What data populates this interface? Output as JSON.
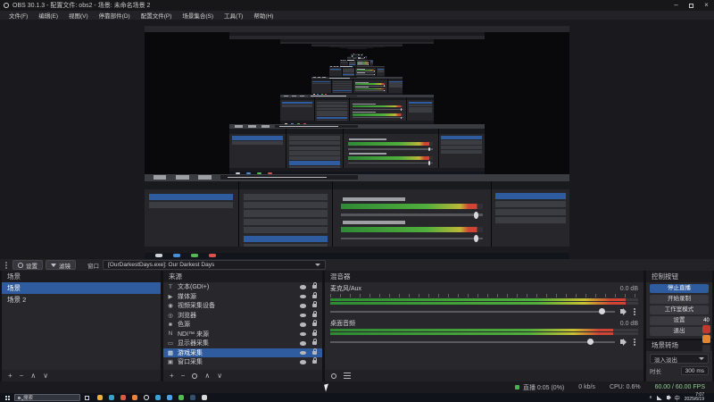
{
  "titlebar": {
    "title": "OBS 30.1.3 - 配置文件: obs2 - 场景: 未命名场景 2",
    "minimize_glyph": "–",
    "close_glyph": "×"
  },
  "menubar": {
    "items": [
      "文件(F)",
      "编辑(E)",
      "视图(V)",
      "停靠部件(D)",
      "配置文件(P)",
      "场景集合(S)",
      "工具(T)",
      "帮助(H)"
    ]
  },
  "source_toolbar": {
    "buttons": [
      {
        "label": "设置"
      },
      {
        "label": "滤镜"
      }
    ],
    "window_label": "窗口",
    "window_value": "[OurDarkestDays.exe]: Our Darkest Days"
  },
  "scenes": {
    "title": "场景",
    "selected": 0,
    "items": [
      {
        "name": "场景"
      },
      {
        "name": "场景 2"
      }
    ]
  },
  "sources": {
    "title": "来源",
    "selected": 7,
    "items": [
      {
        "name": "文本(GDI+)",
        "icon": "T"
      },
      {
        "name": "媒体源",
        "icon": "▶"
      },
      {
        "name": "视频采集设备",
        "icon": "◉"
      },
      {
        "name": "浏览器",
        "icon": "◎"
      },
      {
        "name": "色源",
        "icon": "■"
      },
      {
        "name": "NDI™ 来源",
        "icon": "N"
      },
      {
        "name": "显示器采集",
        "icon": "▭"
      },
      {
        "name": "游戏采集",
        "icon": "▦"
      },
      {
        "name": "窗口采集",
        "icon": "▣"
      }
    ]
  },
  "mixer": {
    "title": "混音器",
    "channels": [
      {
        "name": "麦克风/Aux",
        "db": "0.0 dB",
        "level": 96
      },
      {
        "name": "桌面音频",
        "db": "0.0 dB",
        "level": 92
      }
    ]
  },
  "controls": {
    "title": "控制按钮",
    "buttons": [
      {
        "label": "停止直播",
        "active": true
      },
      {
        "label": "开始录制",
        "active": false
      },
      {
        "label": "工作室模式",
        "active": false
      },
      {
        "label": "设置",
        "active": false
      },
      {
        "label": "退出",
        "active": false
      }
    ]
  },
  "transitions": {
    "title": "场景转场",
    "value": "淡入淡出",
    "duration_label": "时长",
    "duration_value": "300 ms"
  },
  "statusbar": {
    "stream_label": "直播 0:05 (0%)",
    "bitrate": "0 kb/s",
    "cpu": "CPU: 0.6%",
    "fps": "60.00 / 60.00 FPS"
  },
  "overlay_widget": {
    "value": "40"
  },
  "panel_footers": {
    "scenes": [
      "add",
      "remove",
      "up",
      "down"
    ],
    "sources": [
      "add",
      "remove",
      "gear",
      "up",
      "down"
    ],
    "mixer": [
      "gear",
      "sliders"
    ]
  },
  "taskbar": {
    "search_placeholder": "搜索",
    "ime_label": "中",
    "time": "7:07",
    "date": "2025/6/19",
    "apps": [
      {
        "name": "file-explorer",
        "color": "#e8b23d"
      },
      {
        "name": "edge",
        "color": "#35a3c8"
      },
      {
        "name": "chrome",
        "color": "#d85b45"
      },
      {
        "name": "firefox",
        "color": "#e8843d"
      },
      {
        "name": "obs",
        "color": "#eceff1"
      },
      {
        "name": "vscode",
        "color": "#3f9fd8"
      },
      {
        "name": "qq",
        "color": "#4aa3e8"
      },
      {
        "name": "wechat",
        "color": "#57b956"
      },
      {
        "name": "steam",
        "color": "#33506e"
      },
      {
        "name": "notepad",
        "color": "#d8d8d8"
      }
    ]
  },
  "colors": {
    "accent_blue": "#2e5c9e",
    "meter_green": "#4fae3c",
    "meter_red": "#cf4434",
    "panel_bg": "#28282c"
  }
}
